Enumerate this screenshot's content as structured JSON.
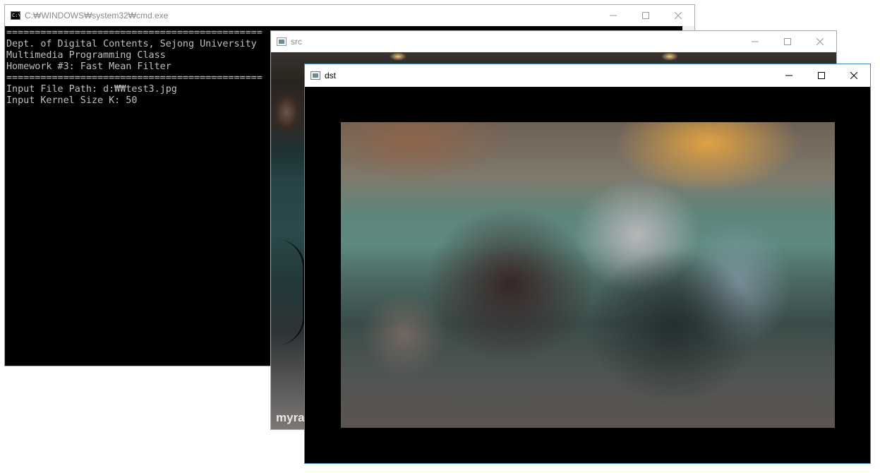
{
  "windows": {
    "cmd": {
      "title": "C:₩WINDOWS₩system32₩cmd.exe",
      "icon": "cmd-icon",
      "console_text": "=============================================\nDept. of Digital Contents, Sejong University\nMultimedia Programming Class\nHomework #3: Fast Mean Filter\n=============================================\nInput File Path: d:₩₩test3.jpg\nInput Kernel Size K: 50"
    },
    "src": {
      "title": "src",
      "icon": "image-window-icon",
      "watermark": "myra"
    },
    "dst": {
      "title": "dst",
      "icon": "image-window-icon"
    }
  },
  "colors": {
    "console_bg": "#000000",
    "console_fg": "#c0c0c0",
    "active_border": "#3a88d8"
  }
}
